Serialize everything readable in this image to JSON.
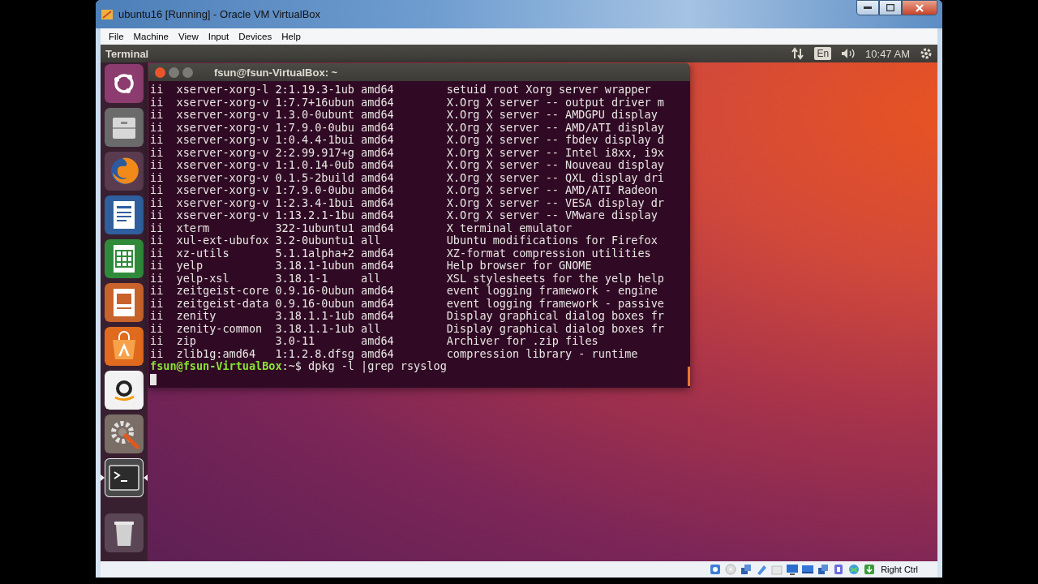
{
  "window": {
    "title": "ubuntu16 [Running] - Oracle VM VirtualBox"
  },
  "menu": [
    "File",
    "Machine",
    "View",
    "Input",
    "Devices",
    "Help"
  ],
  "top_panel": {
    "app_name": "Terminal",
    "keyboard_layout": "En",
    "clock": "10:47 AM"
  },
  "launcher": [
    {
      "kind": "dash",
      "active": false
    },
    {
      "kind": "files",
      "active": false
    },
    {
      "kind": "browser",
      "active": false
    },
    {
      "kind": "writer",
      "active": false
    },
    {
      "kind": "calc",
      "active": false
    },
    {
      "kind": "impress",
      "active": false
    },
    {
      "kind": "software",
      "active": false
    },
    {
      "kind": "shop",
      "active": false
    },
    {
      "kind": "settings",
      "active": false
    },
    {
      "kind": "terminal",
      "active": true
    },
    {
      "kind": "trash",
      "active": false
    }
  ],
  "terminal": {
    "title": "fsun@fsun-VirtualBox: ~",
    "rows": [
      {
        "status": "ii",
        "name": "xserver-xorg-l",
        "version": "2:1.19.3-1ub",
        "arch": "amd64",
        "description": "setuid root Xorg server wrapper"
      },
      {
        "status": "ii",
        "name": "xserver-xorg-v",
        "version": "1:7.7+16ubun",
        "arch": "amd64",
        "description": "X.Org X server -- output driver m"
      },
      {
        "status": "ii",
        "name": "xserver-xorg-v",
        "version": "1.3.0-0ubunt",
        "arch": "amd64",
        "description": "X.Org X server -- AMDGPU display"
      },
      {
        "status": "ii",
        "name": "xserver-xorg-v",
        "version": "1:7.9.0-0ubu",
        "arch": "amd64",
        "description": "X.Org X server -- AMD/ATI display"
      },
      {
        "status": "ii",
        "name": "xserver-xorg-v",
        "version": "1:0.4.4-1bui",
        "arch": "amd64",
        "description": "X.Org X server -- fbdev display d"
      },
      {
        "status": "ii",
        "name": "xserver-xorg-v",
        "version": "2:2.99.917+g",
        "arch": "amd64",
        "description": "X.Org X server -- Intel i8xx, i9x"
      },
      {
        "status": "ii",
        "name": "xserver-xorg-v",
        "version": "1:1.0.14-0ub",
        "arch": "amd64",
        "description": "X.Org X server -- Nouveau display"
      },
      {
        "status": "ii",
        "name": "xserver-xorg-v",
        "version": "0.1.5-2build",
        "arch": "amd64",
        "description": "X.Org X server -- QXL display dri"
      },
      {
        "status": "ii",
        "name": "xserver-xorg-v",
        "version": "1:7.9.0-0ubu",
        "arch": "amd64",
        "description": "X.Org X server -- AMD/ATI Radeon"
      },
      {
        "status": "ii",
        "name": "xserver-xorg-v",
        "version": "1:2.3.4-1bui",
        "arch": "amd64",
        "description": "X.Org X server -- VESA display dr"
      },
      {
        "status": "ii",
        "name": "xserver-xorg-v",
        "version": "1:13.2.1-1bu",
        "arch": "amd64",
        "description": "X.Org X server -- VMware display"
      },
      {
        "status": "ii",
        "name": "xterm",
        "version": "322-1ubuntu1",
        "arch": "amd64",
        "description": "X terminal emulator"
      },
      {
        "status": "ii",
        "name": "xul-ext-ubufox",
        "version": "3.2-0ubuntu1",
        "arch": "all",
        "description": "Ubuntu modifications for Firefox"
      },
      {
        "status": "ii",
        "name": "xz-utils",
        "version": "5.1.1alpha+2",
        "arch": "amd64",
        "description": "XZ-format compression utilities"
      },
      {
        "status": "ii",
        "name": "yelp",
        "version": "3.18.1-1ubun",
        "arch": "amd64",
        "description": "Help browser for GNOME"
      },
      {
        "status": "ii",
        "name": "yelp-xsl",
        "version": "3.18.1-1",
        "arch": "all",
        "description": "XSL stylesheets for the yelp help"
      },
      {
        "status": "ii",
        "name": "zeitgeist-core",
        "version": "0.9.16-0ubun",
        "arch": "amd64",
        "description": "event logging framework - engine"
      },
      {
        "status": "ii",
        "name": "zeitgeist-data",
        "version": "0.9.16-0ubun",
        "arch": "amd64",
        "description": "event logging framework - passive"
      },
      {
        "status": "ii",
        "name": "zenity",
        "version": "3.18.1.1-1ub",
        "arch": "amd64",
        "description": "Display graphical dialog boxes fr"
      },
      {
        "status": "ii",
        "name": "zenity-common",
        "version": "3.18.1.1-1ub",
        "arch": "all",
        "description": "Display graphical dialog boxes fr"
      },
      {
        "status": "ii",
        "name": "zip",
        "version": "3.0-11",
        "arch": "amd64",
        "description": "Archiver for .zip files"
      },
      {
        "status": "ii",
        "name": "zlib1g:amd64",
        "version": "1:1.2.8.dfsg",
        "arch": "amd64",
        "description": "compression library - runtime"
      }
    ],
    "prompt": {
      "user_host": "fsun@fsun-VirtualBox",
      "command": ":~$ dpkg -l |grep rsyslog"
    }
  },
  "status_bar": {
    "host_key": "Right Ctrl"
  }
}
